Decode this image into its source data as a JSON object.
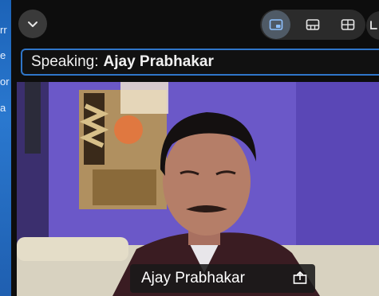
{
  "desktop": {
    "background_color": "#2a78cf",
    "edge_letters": [
      "rr",
      "e",
      "or",
      "a"
    ]
  },
  "toolbar": {
    "collapse_icon": "chevron-down-icon",
    "layouts": [
      {
        "icon": "speaker-view-icon",
        "active": true
      },
      {
        "icon": "filmstrip-view-icon",
        "active": false
      },
      {
        "icon": "gallery-view-icon",
        "active": false
      }
    ]
  },
  "speaking": {
    "label": "Speaking:",
    "name": "Ajay Prabhakar",
    "border_color": "#2f76c9"
  },
  "video": {
    "participant_name": "Ajay Prabhakar",
    "share_icon": "share-screen-icon"
  }
}
